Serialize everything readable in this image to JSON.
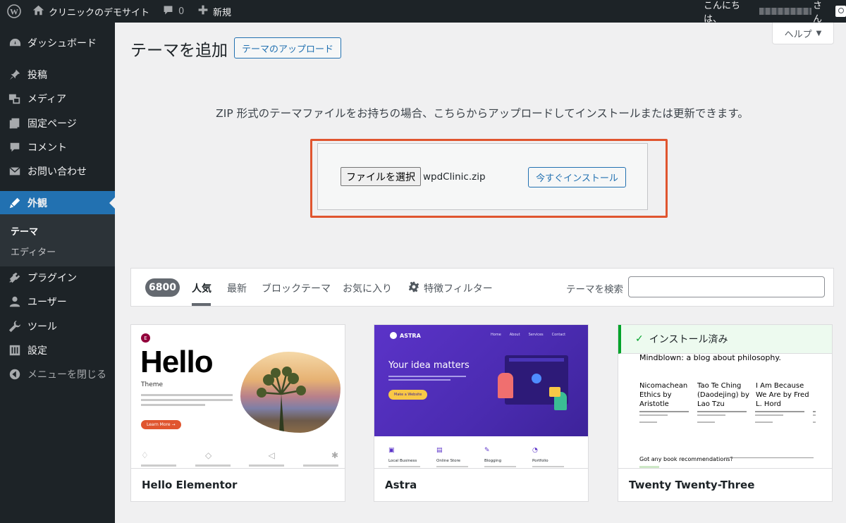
{
  "adminbar": {
    "site_name": "クリニックのデモサイト",
    "comments_count": "0",
    "new_label": "新規",
    "greeting": "こんにちは、",
    "greeting_suffix": "さん"
  },
  "sidebar": {
    "items": [
      {
        "label": "ダッシュボード",
        "icon": "dashboard-icon"
      },
      {
        "label": "投稿",
        "icon": "pin-icon"
      },
      {
        "label": "メディア",
        "icon": "media-icon"
      },
      {
        "label": "固定ページ",
        "icon": "page-icon"
      },
      {
        "label": "コメント",
        "icon": "comment-icon"
      },
      {
        "label": "お問い合わせ",
        "icon": "mail-icon"
      },
      {
        "label": "外観",
        "icon": "appearance-icon"
      },
      {
        "label": "プラグイン",
        "icon": "plugin-icon"
      },
      {
        "label": "ユーザー",
        "icon": "user-icon"
      },
      {
        "label": "ツール",
        "icon": "wrench-icon"
      },
      {
        "label": "設定",
        "icon": "settings-icon"
      },
      {
        "label": "メニューを閉じる",
        "icon": "collapse-icon"
      }
    ],
    "submenu": [
      "テーマ",
      "エディター"
    ]
  },
  "help_label": "ヘルプ",
  "page": {
    "title": "テーマを追加",
    "upload_button": "テーマのアップロード",
    "upload_description": "ZIP 形式のテーマファイルをお持ちの場合、こちらからアップロードしてインストールまたは更新できます。",
    "choose_file_label": "ファイルを選択",
    "file_name": "wpdClinic.zip",
    "install_button": "今すぐインストール"
  },
  "filters": {
    "count": "6800",
    "tabs": [
      "人気",
      "最新",
      "ブロックテーマ",
      "お気に入り"
    ],
    "feature_filter": "特徴フィルター",
    "search_label": "テーマを検索",
    "search_value": ""
  },
  "themes": [
    {
      "name": "Hello Elementor",
      "preview": {
        "title": "Hello",
        "subtitle": "Theme",
        "button": "Learn More →"
      }
    },
    {
      "name": "Astra",
      "preview": {
        "brand": "ASTRA",
        "nav": [
          "Home",
          "About",
          "Services",
          "Contact"
        ],
        "headline": "Your idea matters",
        "button": "Make a Website",
        "features": [
          "Local Business",
          "Online Store",
          "Blogging",
          "Portfolio"
        ]
      }
    },
    {
      "name": "Twenty Twenty-Three",
      "installed_label": "インストール済み",
      "preview": {
        "headline": "Mindblown: a blog about philosophy.",
        "posts": [
          "Nicomachean Ethics by Aristotle",
          "Tao Te Ching (Daodejing) by Lao Tzu",
          "I Am Because We Are by Fred L. Hord"
        ],
        "footer": "Got any book recommendations?"
      }
    }
  ],
  "colors": {
    "admin_dark": "#1d2327",
    "accent": "#2271b1",
    "highlight": "#e0552f",
    "installed_green": "#00a32a"
  }
}
